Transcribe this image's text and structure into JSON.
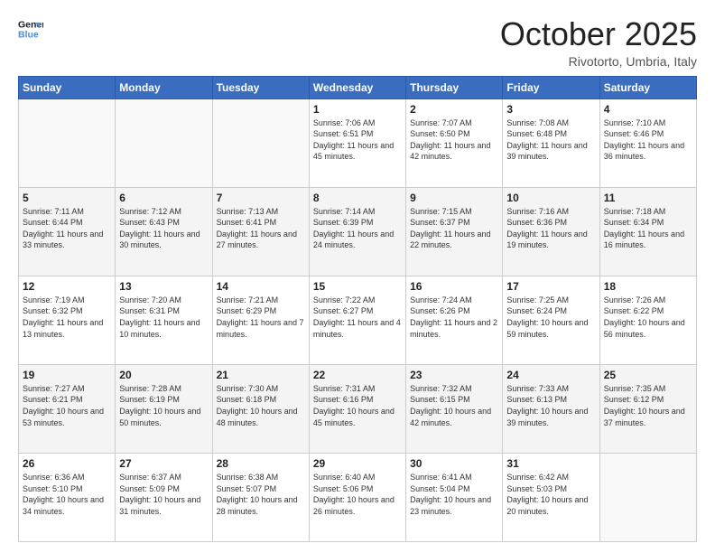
{
  "header": {
    "logo_line1": "General",
    "logo_line2": "Blue",
    "month": "October 2025",
    "location": "Rivotorto, Umbria, Italy"
  },
  "weekdays": [
    "Sunday",
    "Monday",
    "Tuesday",
    "Wednesday",
    "Thursday",
    "Friday",
    "Saturday"
  ],
  "weeks": [
    [
      {
        "day": null
      },
      {
        "day": null
      },
      {
        "day": null
      },
      {
        "day": 1,
        "sunrise": "7:06 AM",
        "sunset": "6:51 PM",
        "daylight": "11 hours and 45 minutes."
      },
      {
        "day": 2,
        "sunrise": "7:07 AM",
        "sunset": "6:50 PM",
        "daylight": "11 hours and 42 minutes."
      },
      {
        "day": 3,
        "sunrise": "7:08 AM",
        "sunset": "6:48 PM",
        "daylight": "11 hours and 39 minutes."
      },
      {
        "day": 4,
        "sunrise": "7:10 AM",
        "sunset": "6:46 PM",
        "daylight": "11 hours and 36 minutes."
      }
    ],
    [
      {
        "day": 5,
        "sunrise": "7:11 AM",
        "sunset": "6:44 PM",
        "daylight": "11 hours and 33 minutes."
      },
      {
        "day": 6,
        "sunrise": "7:12 AM",
        "sunset": "6:43 PM",
        "daylight": "11 hours and 30 minutes."
      },
      {
        "day": 7,
        "sunrise": "7:13 AM",
        "sunset": "6:41 PM",
        "daylight": "11 hours and 27 minutes."
      },
      {
        "day": 8,
        "sunrise": "7:14 AM",
        "sunset": "6:39 PM",
        "daylight": "11 hours and 24 minutes."
      },
      {
        "day": 9,
        "sunrise": "7:15 AM",
        "sunset": "6:37 PM",
        "daylight": "11 hours and 22 minutes."
      },
      {
        "day": 10,
        "sunrise": "7:16 AM",
        "sunset": "6:36 PM",
        "daylight": "11 hours and 19 minutes."
      },
      {
        "day": 11,
        "sunrise": "7:18 AM",
        "sunset": "6:34 PM",
        "daylight": "11 hours and 16 minutes."
      }
    ],
    [
      {
        "day": 12,
        "sunrise": "7:19 AM",
        "sunset": "6:32 PM",
        "daylight": "11 hours and 13 minutes."
      },
      {
        "day": 13,
        "sunrise": "7:20 AM",
        "sunset": "6:31 PM",
        "daylight": "11 hours and 10 minutes."
      },
      {
        "day": 14,
        "sunrise": "7:21 AM",
        "sunset": "6:29 PM",
        "daylight": "11 hours and 7 minutes."
      },
      {
        "day": 15,
        "sunrise": "7:22 AM",
        "sunset": "6:27 PM",
        "daylight": "11 hours and 4 minutes."
      },
      {
        "day": 16,
        "sunrise": "7:24 AM",
        "sunset": "6:26 PM",
        "daylight": "11 hours and 2 minutes."
      },
      {
        "day": 17,
        "sunrise": "7:25 AM",
        "sunset": "6:24 PM",
        "daylight": "10 hours and 59 minutes."
      },
      {
        "day": 18,
        "sunrise": "7:26 AM",
        "sunset": "6:22 PM",
        "daylight": "10 hours and 56 minutes."
      }
    ],
    [
      {
        "day": 19,
        "sunrise": "7:27 AM",
        "sunset": "6:21 PM",
        "daylight": "10 hours and 53 minutes."
      },
      {
        "day": 20,
        "sunrise": "7:28 AM",
        "sunset": "6:19 PM",
        "daylight": "10 hours and 50 minutes."
      },
      {
        "day": 21,
        "sunrise": "7:30 AM",
        "sunset": "6:18 PM",
        "daylight": "10 hours and 48 minutes."
      },
      {
        "day": 22,
        "sunrise": "7:31 AM",
        "sunset": "6:16 PM",
        "daylight": "10 hours and 45 minutes."
      },
      {
        "day": 23,
        "sunrise": "7:32 AM",
        "sunset": "6:15 PM",
        "daylight": "10 hours and 42 minutes."
      },
      {
        "day": 24,
        "sunrise": "7:33 AM",
        "sunset": "6:13 PM",
        "daylight": "10 hours and 39 minutes."
      },
      {
        "day": 25,
        "sunrise": "7:35 AM",
        "sunset": "6:12 PM",
        "daylight": "10 hours and 37 minutes."
      }
    ],
    [
      {
        "day": 26,
        "sunrise": "6:36 AM",
        "sunset": "5:10 PM",
        "daylight": "10 hours and 34 minutes."
      },
      {
        "day": 27,
        "sunrise": "6:37 AM",
        "sunset": "5:09 PM",
        "daylight": "10 hours and 31 minutes."
      },
      {
        "day": 28,
        "sunrise": "6:38 AM",
        "sunset": "5:07 PM",
        "daylight": "10 hours and 28 minutes."
      },
      {
        "day": 29,
        "sunrise": "6:40 AM",
        "sunset": "5:06 PM",
        "daylight": "10 hours and 26 minutes."
      },
      {
        "day": 30,
        "sunrise": "6:41 AM",
        "sunset": "5:04 PM",
        "daylight": "10 hours and 23 minutes."
      },
      {
        "day": 31,
        "sunrise": "6:42 AM",
        "sunset": "5:03 PM",
        "daylight": "10 hours and 20 minutes."
      },
      {
        "day": null
      }
    ]
  ]
}
